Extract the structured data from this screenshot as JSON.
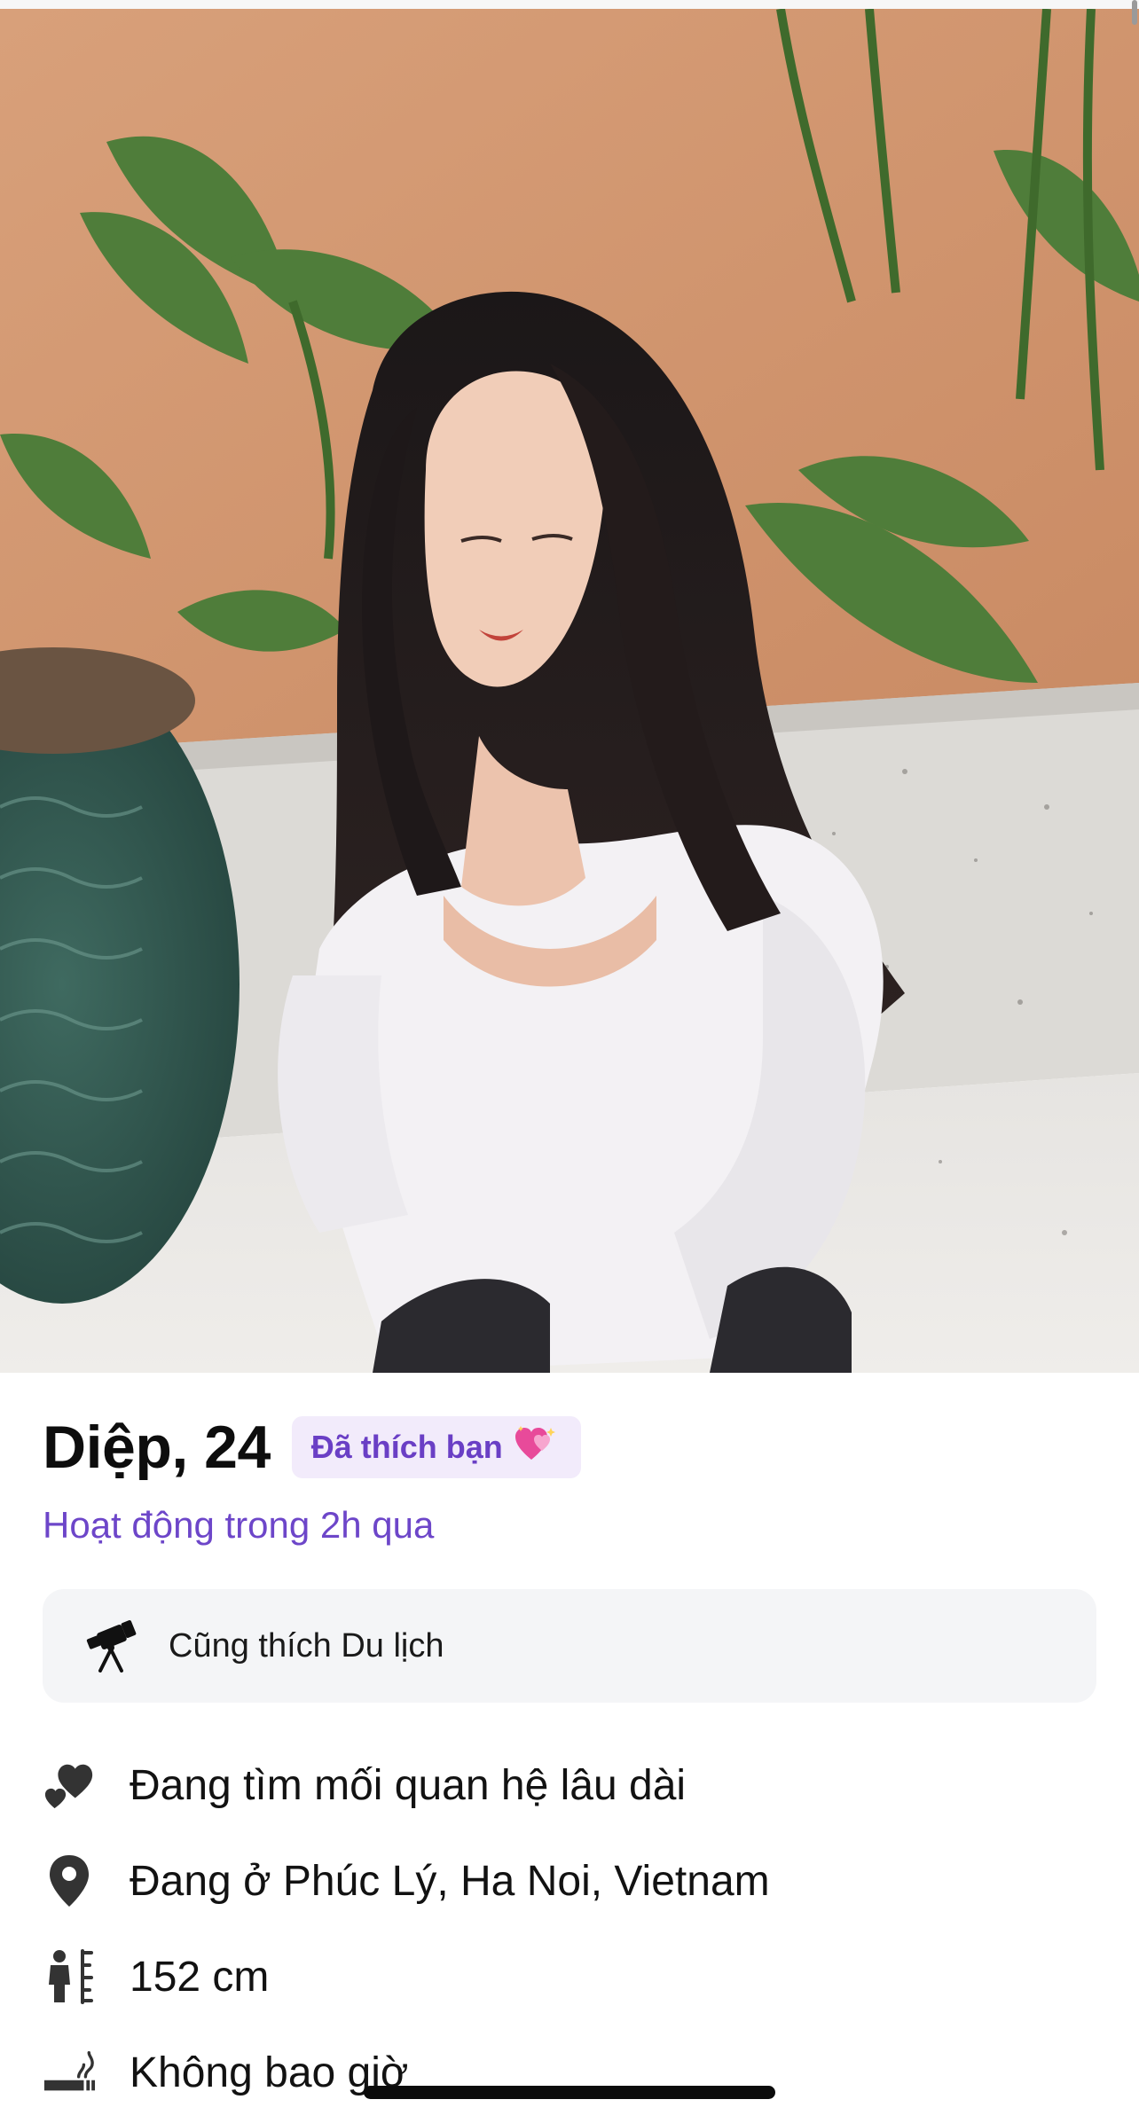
{
  "profile": {
    "name_age": "Diệp, 24",
    "liked_badge": {
      "label": "Đã thích bạn",
      "icon": "sparkling-hearts-icon",
      "bg_color": "#f2ebfb",
      "text_color": "#6a3fc5"
    },
    "activity_status": "Hoạt động trong 2h qua",
    "photo": {
      "icon": "profile-photo",
      "description_hidden": true
    }
  },
  "shared_interest": {
    "icon": "telescope-icon",
    "text": "Cũng thích Du lịch"
  },
  "details": [
    {
      "icon": "hearts-icon",
      "text": "Đang tìm mối quan hệ lâu dài"
    },
    {
      "icon": "location-pin-icon",
      "text": "Đang ở Phúc Lý, Ha Noi, Vietnam"
    },
    {
      "icon": "height-icon",
      "text": "152 cm"
    },
    {
      "icon": "smoking-icon",
      "text": "Không bao giờ"
    }
  ],
  "colors": {
    "accent": "#6d46c9",
    "card_bg": "#f4f5f7",
    "text": "#121212"
  }
}
